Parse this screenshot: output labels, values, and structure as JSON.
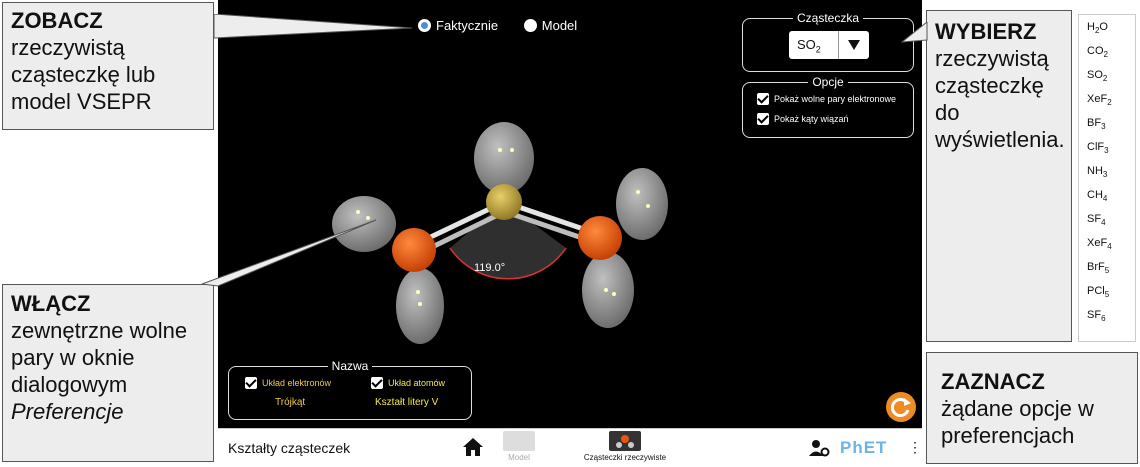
{
  "callouts": {
    "see": {
      "head": "ZOBACZ",
      "body": [
        "rzeczywistą",
        "cząsteczkę lub",
        "model VSEPR"
      ]
    },
    "choose": {
      "head": "WYBIERZ",
      "body": [
        "rzeczywistą",
        "cząsteczkę",
        "do",
        "wyświetlenia."
      ]
    },
    "enable": {
      "head": "WŁĄCZ",
      "body_plain": [
        "zewnętrzne wolne",
        "pary w oknie",
        "dialogowym"
      ],
      "body_italic": "Preferencje"
    },
    "mark": {
      "head": "ZAZNACZ",
      "body": [
        "żądane opcje w",
        "preferencjach"
      ]
    }
  },
  "view_mode": {
    "options": [
      "Faktycznie",
      "Model"
    ],
    "selected": "Faktycznie"
  },
  "molecule_panel": {
    "title": "Cząsteczka",
    "selected": "SO",
    "selected_sub": "2"
  },
  "options_panel": {
    "title": "Opcje",
    "items": [
      {
        "label": "Pokaż wolne pary elektronowe",
        "checked": true
      },
      {
        "label": "Pokaż kąty wiązań",
        "checked": true
      }
    ]
  },
  "name_panel": {
    "title": "Nazwa",
    "items": [
      {
        "label": "Układ elektronów",
        "checked": true,
        "value": "Trójkąt"
      },
      {
        "label": "Układ atomów",
        "checked": true,
        "value": "Kształt litery V"
      }
    ]
  },
  "bond_angle": "119.0°",
  "toolbar": {
    "title": "Kształty cząsteczek",
    "screens": [
      "Model",
      "Cząsteczki rzeczywiste"
    ],
    "brand": "PhET"
  },
  "molecule_list": [
    {
      "base": "H",
      "sub": "2",
      "tail": "O"
    },
    {
      "base": "CO",
      "sub": "2",
      "tail": ""
    },
    {
      "base": "SO",
      "sub": "2",
      "tail": ""
    },
    {
      "base": "XeF",
      "sub": "2",
      "tail": ""
    },
    {
      "base": "BF",
      "sub": "3",
      "tail": ""
    },
    {
      "base": "ClF",
      "sub": "3",
      "tail": ""
    },
    {
      "base": "NH",
      "sub": "3",
      "tail": ""
    },
    {
      "base": "CH",
      "sub": "4",
      "tail": ""
    },
    {
      "base": "SF",
      "sub": "4",
      "tail": ""
    },
    {
      "base": "XeF",
      "sub": "4",
      "tail": ""
    },
    {
      "base": "BrF",
      "sub": "5",
      "tail": ""
    },
    {
      "base": "PCl",
      "sub": "5",
      "tail": ""
    },
    {
      "base": "SF",
      "sub": "6",
      "tail": ""
    }
  ],
  "colors": {
    "sulfur": "#c9a93a",
    "oxygen": "#e8550f",
    "lone_pair": "#c4c4c4",
    "accent": "#f08a24",
    "bond": "#e5e5e5"
  }
}
